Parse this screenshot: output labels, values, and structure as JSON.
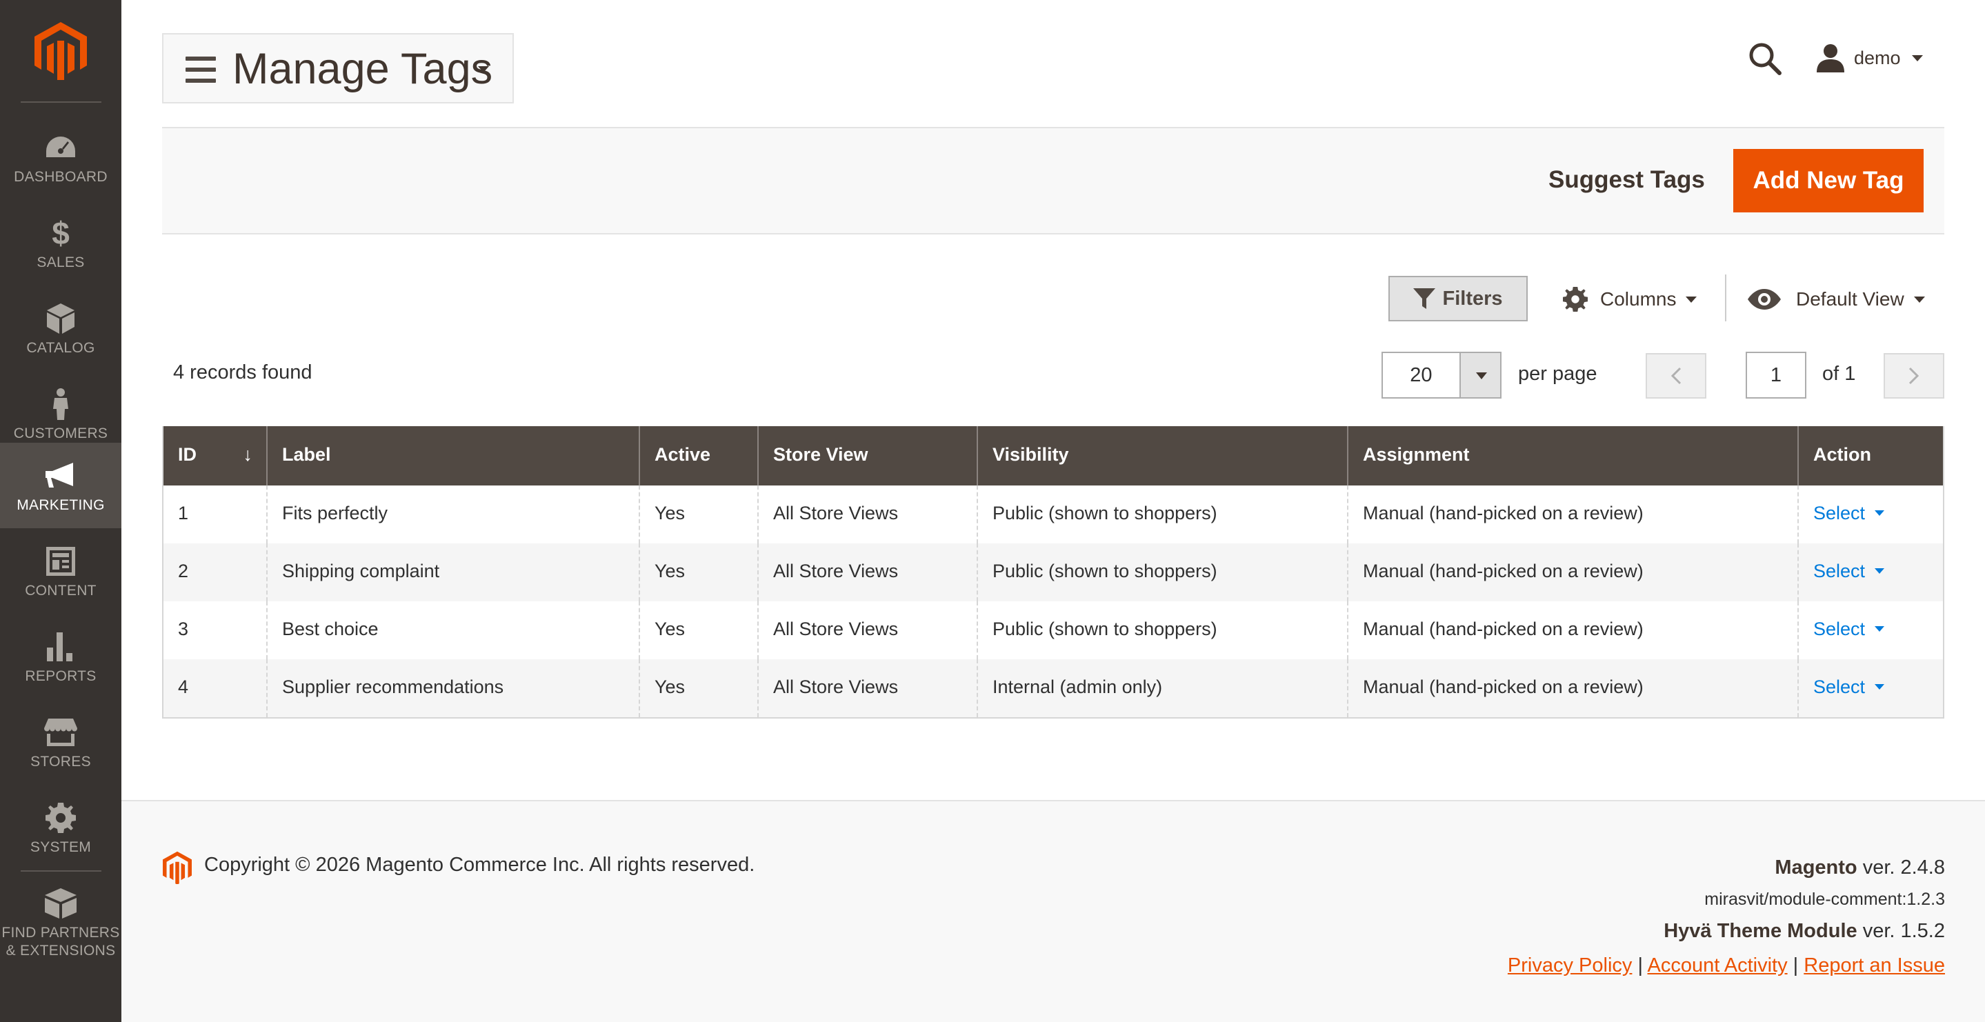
{
  "sidebar": {
    "items": [
      {
        "label": "DASHBOARD",
        "icon": "dashboard-icon"
      },
      {
        "label": "SALES",
        "icon": "dollar-icon"
      },
      {
        "label": "CATALOG",
        "icon": "box-icon"
      },
      {
        "label": "CUSTOMERS",
        "icon": "person-icon"
      },
      {
        "label": "MARKETING",
        "icon": "megaphone-icon",
        "active": true
      },
      {
        "label": "CONTENT",
        "icon": "content-icon"
      },
      {
        "label": "REPORTS",
        "icon": "bar-chart-icon"
      },
      {
        "label": "STORES",
        "icon": "store-icon"
      },
      {
        "label": "SYSTEM",
        "icon": "gear-icon"
      }
    ],
    "partners_line1": "FIND PARTNERS",
    "partners_line2": "& EXTENSIONS"
  },
  "header": {
    "title": "Manage Tags",
    "user": "demo"
  },
  "actions": {
    "suggest": "Suggest Tags",
    "add": "Add New Tag"
  },
  "controls": {
    "filters": "Filters",
    "columns": "Columns",
    "view": "Default View"
  },
  "pager": {
    "records": "4 records found",
    "per_page_value": "20",
    "per_page_label": "per page",
    "page": "1",
    "of": "of 1"
  },
  "table": {
    "headers": [
      "ID",
      "Label",
      "Active",
      "Store View",
      "Visibility",
      "Assignment",
      "Action"
    ],
    "sort_indicator": "↓",
    "rows": [
      {
        "id": "1",
        "label": "Fits perfectly",
        "active": "Yes",
        "store": "All Store Views",
        "visibility": "Public (shown to shoppers)",
        "assignment": "Manual (hand-picked on a review)",
        "action": "Select"
      },
      {
        "id": "2",
        "label": "Shipping complaint",
        "active": "Yes",
        "store": "All Store Views",
        "visibility": "Public (shown to shoppers)",
        "assignment": "Manual (hand-picked on a review)",
        "action": "Select"
      },
      {
        "id": "3",
        "label": "Best choice",
        "active": "Yes",
        "store": "All Store Views",
        "visibility": "Public (shown to shoppers)",
        "assignment": "Manual (hand-picked on a review)",
        "action": "Select"
      },
      {
        "id": "4",
        "label": "Supplier recommendations",
        "active": "Yes",
        "store": "All Store Views",
        "visibility": "Internal (admin only)",
        "assignment": "Manual (hand-picked on a review)",
        "action": "Select"
      }
    ]
  },
  "footer": {
    "copyright": "Copyright © 2026 Magento Commerce Inc. All rights reserved.",
    "magento_name": "Magento",
    "magento_ver": " ver. 2.4.8",
    "module": "mirasvit/module-comment:1.2.3",
    "hyva_name": "Hyvä Theme Module",
    "hyva_ver": " ver. 1.5.2",
    "links": [
      "Privacy Policy",
      "Account Activity",
      "Report an Issue"
    ],
    "separator": "|"
  },
  "colors": {
    "sidebar_bg": "#373330",
    "accent": "#eb5202",
    "table_header": "#514943",
    "link": "#007bdb"
  }
}
